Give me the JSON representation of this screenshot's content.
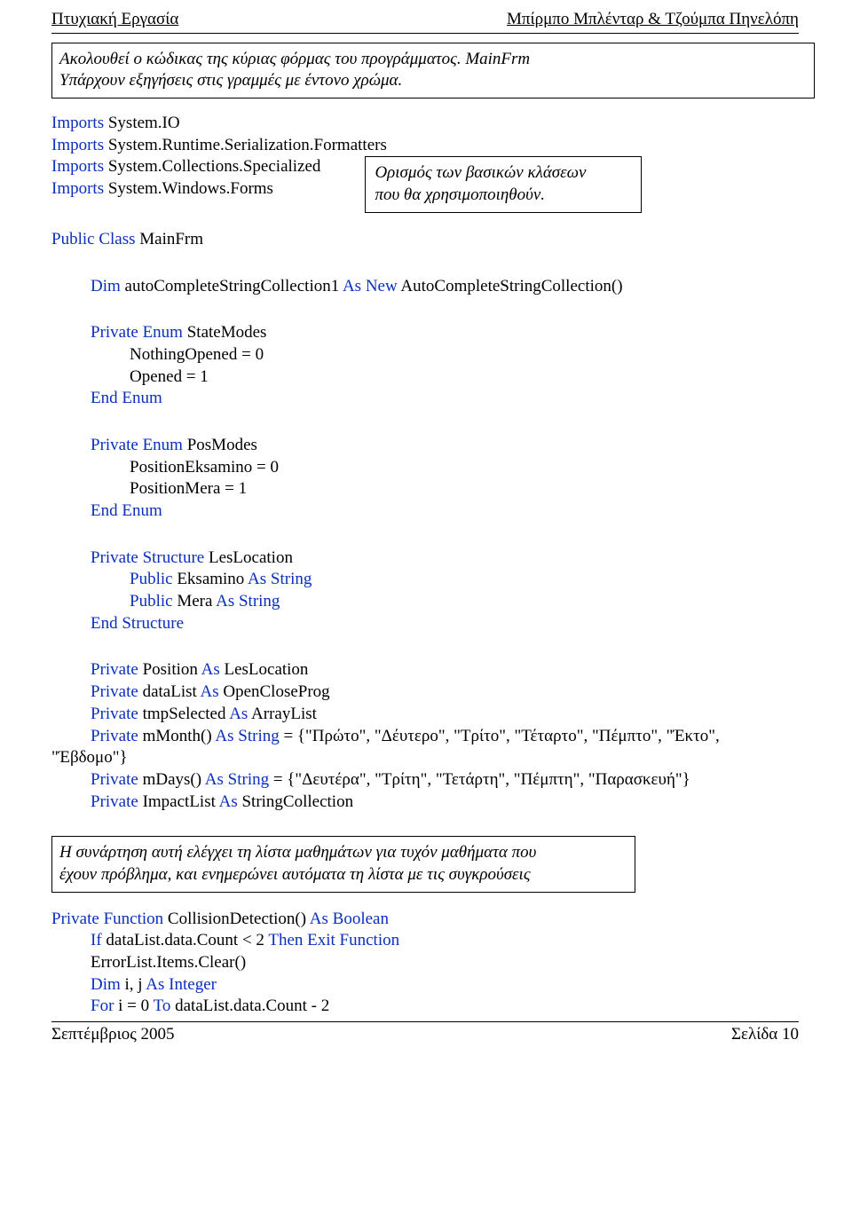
{
  "header": {
    "left": "Πτυχιακή Εργασία",
    "right": "Μπίρμπο Μπλένταρ & Τζούμπα Πηνελόπη"
  },
  "intro_box": {
    "line1": "Ακολουθεί ο κώδικας  της κύριας φόρμας του προγράμματος. MainFrm",
    "line2": "Υπάρχουν εξηγήσεις στις γραμμές με έντονο χρώμα."
  },
  "imports": {
    "kw": "Imports",
    "io": "System.IO",
    "runtime": "System.Runtime.Serialization.Formatters",
    "collections": "System.Collections.Specialized",
    "forms": "System.Windows.Forms"
  },
  "side_box": {
    "l1": "Ορισμός των βασικών κλάσεων",
    "l2": "που θα χρησιμοποιηθούν."
  },
  "class_decl": {
    "public": "Public",
    "class": "Class",
    "name": "MainFrm"
  },
  "dim_auto": {
    "dim": "Dim",
    "var": "autoCompleteStringCollection1",
    "askw": "As",
    "newkw": "New",
    "ctor": "AutoCompleteStringCollection()"
  },
  "enum_state": {
    "private": "Private",
    "enumkw": "Enum",
    "name": "StateModes",
    "l1": "NothingOpened = 0",
    "l2": "Opened = 1",
    "end": "End Enum"
  },
  "enum_pos": {
    "private": "Private",
    "enumkw": "Enum",
    "name": "PosModes",
    "l1": "PositionEksamino = 0",
    "l2": "PositionMera = 1",
    "end": "End Enum"
  },
  "struct": {
    "private": "Private",
    "structkw": "Structure",
    "name": "LesLocation",
    "pub": "Public",
    "f1": "Eksamino",
    "f2": "Mera",
    "askw": "As",
    "string": "String",
    "end": "End Structure"
  },
  "vars": {
    "private": "Private",
    "pos_var": "Position",
    "askw": "As",
    "pos_type": "LesLocation",
    "datalist_var": "dataList",
    "datalist_type": "OpenCloseProg",
    "tmp_var": "tmpSelected",
    "tmp_type": "ArrayList",
    "mmonth_var": "mMonth()",
    "string": "String",
    "mmonth_init": " = {\"Πρώτο\", \"Δέυτερο\", \"Τρίτο\", \"Τέταρτο\", \"Πέμπτο\", \"Έκτο\",",
    "mmonth_cont": "\"Έβδομο\"}",
    "mdays_var": "mDays()",
    "mdays_init": " = {\"Δευτέρα\", \"Τρίτη\", \"Τετάρτη\", \"Πέμπτη\", \"Παρασκευή\"}",
    "impact_var": "ImpactList",
    "impact_type": "StringCollection"
  },
  "comment_box": {
    "l1": "Η συνάρτηση αυτή ελέγχει τη λίστα μαθημάτων για τυχόν μαθήματα που",
    "l2": "έχουν πρόβλημα, και ενημερώνει αυτόματα τη λίστα με τις συγκρούσεις"
  },
  "func": {
    "private": "Private",
    "function": "Function",
    "name": "CollisionDetection()",
    "askw": "As",
    "boolean": "Boolean",
    "l1_if": "If",
    "l1_body": "dataList.data.Count < 2",
    "l1_then": "Then Exit Function",
    "l2": "ErrorList.Items.Clear()",
    "l3_dim": "Dim",
    "l3_vars": "i, j",
    "l3_as": "As",
    "l3_int": "Integer",
    "l4_for": "For",
    "l4_body": "i = 0",
    "l4_to": "To",
    "l4_rest": "dataList.data.Count - 2"
  },
  "footer": {
    "left": "Σεπτέμβριος 2005",
    "right": "Σελίδα 10"
  }
}
